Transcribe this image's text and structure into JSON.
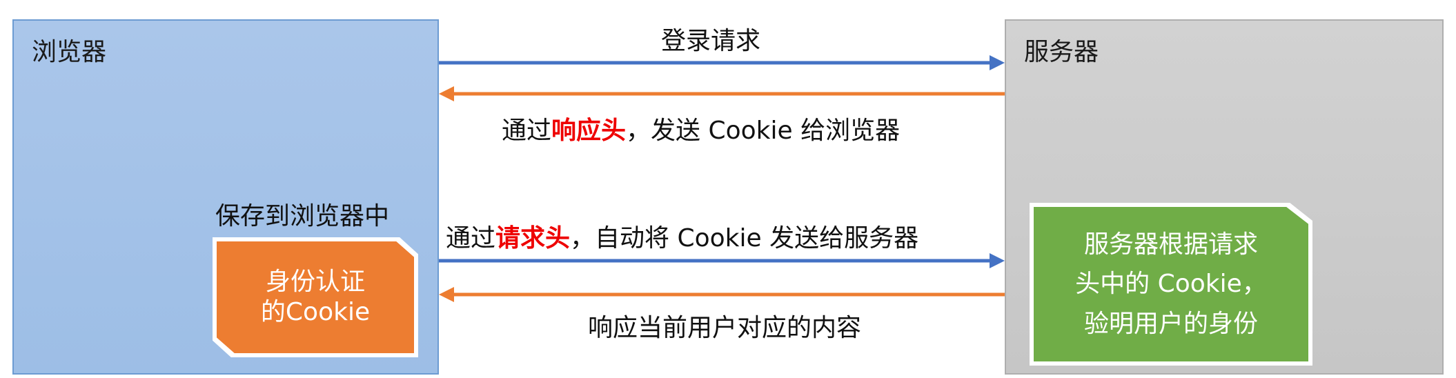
{
  "colors": {
    "request_arrow": "#4472c4",
    "response_arrow": "#ed7d31",
    "highlight_text": "#ee0000",
    "cookie_box": "#ed7d31",
    "verify_box": "#70ad47"
  },
  "browser": {
    "title": "浏览器",
    "store_label": "保存到浏览器中",
    "cookie_box": {
      "line1": "身份认证",
      "line2": "的Cookie"
    }
  },
  "server": {
    "title": "服务器",
    "verify_box": {
      "line1": "服务器根据请求",
      "line2": "头中的 Cookie，",
      "line3": "验明用户的身份"
    }
  },
  "flows": {
    "login_request": "登录请求",
    "set_cookie": {
      "prefix": "通过",
      "highlight": "响应头",
      "suffix": "，发送 Cookie 给浏览器"
    },
    "send_cookie": {
      "prefix": "通过",
      "highlight": "请求头",
      "suffix": "，自动将 Cookie 发送给服务器"
    },
    "response_content": "响应当前用户对应的内容"
  }
}
